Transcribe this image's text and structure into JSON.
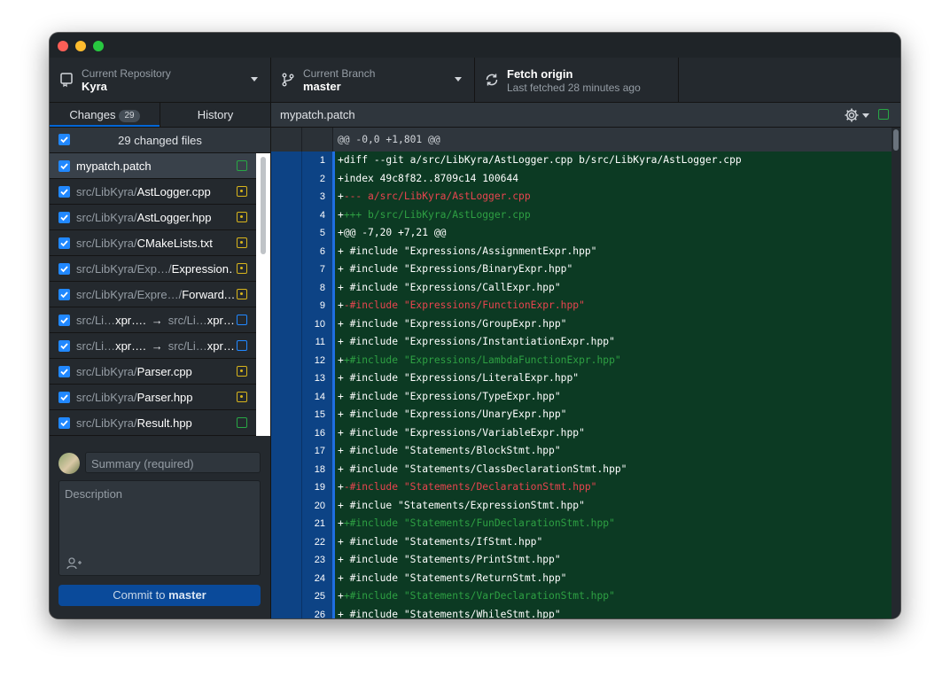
{
  "toolbar": {
    "repo": {
      "label": "Current Repository",
      "value": "Kyra",
      "icon": "repo-icon"
    },
    "branch": {
      "label": "Current Branch",
      "value": "master",
      "icon": "branch-icon"
    },
    "fetch": {
      "label": "Fetch origin",
      "subtitle": "Last fetched 28 minutes ago",
      "icon": "sync-icon"
    }
  },
  "tabs": {
    "changes": "Changes",
    "changes_count": "29",
    "history": "History"
  },
  "files_header": "29 changed files",
  "files": [
    {
      "dir": "",
      "name": "mypatch.patch",
      "status": "added"
    },
    {
      "dir": "src/LibKyra/",
      "name": "AstLogger.cpp",
      "status": "modified"
    },
    {
      "dir": "src/LibKyra/",
      "name": "AstLogger.hpp",
      "status": "modified"
    },
    {
      "dir": "src/LibKyra/",
      "name": "CMakeLists.txt",
      "status": "modified"
    },
    {
      "dir": "src/LibKyra/Exp…/",
      "name": "Expression…",
      "status": "modified"
    },
    {
      "dir": "src/LibKyra/Expre…/",
      "name": "Forward.…",
      "status": "modified"
    },
    {
      "dir": "src/Li…",
      "name": "xpr….",
      "arrow": "→",
      "dir2": "src/Li…",
      "name2": "xpr….",
      "status": "renamed"
    },
    {
      "dir": "src/Li…",
      "name": "xpr….",
      "arrow": "→",
      "dir2": "src/Li…",
      "name2": "xpr….",
      "status": "renamed"
    },
    {
      "dir": "src/LibKyra/",
      "name": "Parser.cpp",
      "status": "modified"
    },
    {
      "dir": "src/LibKyra/",
      "name": "Parser.hpp",
      "status": "modified"
    },
    {
      "dir": "src/LibKyra/",
      "name": "Result.hpp",
      "status": "added"
    }
  ],
  "commit": {
    "summary_placeholder": "Summary (required)",
    "description_placeholder": "Description",
    "button_prefix": "Commit to ",
    "button_branch": "master"
  },
  "diff": {
    "file": "mypatch.patch",
    "hunk": "@@ -0,0 +1,801 @@",
    "lines": [
      {
        "n": "1",
        "pre": "+",
        "text": "diff --git a/src/LibKyra/AstLogger.cpp b/src/LibKyra/AstLogger.cpp",
        "color": "white"
      },
      {
        "n": "2",
        "pre": "+",
        "text": "index 49c8f82..8709c14 100644",
        "color": "white"
      },
      {
        "n": "3",
        "pre": "+",
        "text": "--- a/src/LibKyra/AstLogger.cpp",
        "color": "red"
      },
      {
        "n": "4",
        "pre": "+",
        "text": "+++ b/src/LibKyra/AstLogger.cpp",
        "color": "green"
      },
      {
        "n": "5",
        "pre": "+",
        "text": "@@ -7,20 +7,21 @@",
        "color": "white"
      },
      {
        "n": "6",
        "pre": "+",
        "text": " #include \"Expressions/AssignmentExpr.hpp\"",
        "color": "white"
      },
      {
        "n": "7",
        "pre": "+",
        "text": " #include \"Expressions/BinaryExpr.hpp\"",
        "color": "white"
      },
      {
        "n": "8",
        "pre": "+",
        "text": " #include \"Expressions/CallExpr.hpp\"",
        "color": "white"
      },
      {
        "n": "9",
        "pre": "+",
        "text": "-#include \"Expressions/FunctionExpr.hpp\"",
        "color": "red"
      },
      {
        "n": "10",
        "pre": "+",
        "text": " #include \"Expressions/GroupExpr.hpp\"",
        "color": "white"
      },
      {
        "n": "11",
        "pre": "+",
        "text": " #include \"Expressions/InstantiationExpr.hpp\"",
        "color": "white"
      },
      {
        "n": "12",
        "pre": "+",
        "text": "+#include \"Expressions/LambdaFunctionExpr.hpp\"",
        "color": "green"
      },
      {
        "n": "13",
        "pre": "+",
        "text": " #include \"Expressions/LiteralExpr.hpp\"",
        "color": "white"
      },
      {
        "n": "14",
        "pre": "+",
        "text": " #include \"Expressions/TypeExpr.hpp\"",
        "color": "white"
      },
      {
        "n": "15",
        "pre": "+",
        "text": " #include \"Expressions/UnaryExpr.hpp\"",
        "color": "white"
      },
      {
        "n": "16",
        "pre": "+",
        "text": " #include \"Expressions/VariableExpr.hpp\"",
        "color": "white"
      },
      {
        "n": "17",
        "pre": "+",
        "text": " #include \"Statements/BlockStmt.hpp\"",
        "color": "white"
      },
      {
        "n": "18",
        "pre": "+",
        "text": " #include \"Statements/ClassDeclarationStmt.hpp\"",
        "color": "white"
      },
      {
        "n": "19",
        "pre": "+",
        "text": "-#include \"Statements/DeclarationStmt.hpp\"",
        "color": "red"
      },
      {
        "n": "20",
        "pre": "+",
        "text": " #inclue \"Statements/ExpressionStmt.hpp\"",
        "color": "white"
      },
      {
        "n": "21",
        "pre": "+",
        "text": "+#include \"Statements/FunDeclarationStmt.hpp\"",
        "color": "green"
      },
      {
        "n": "22",
        "pre": "+",
        "text": " #include \"Statements/IfStmt.hpp\"",
        "color": "white"
      },
      {
        "n": "23",
        "pre": "+",
        "text": " #include \"Statements/PrintStmt.hpp\"",
        "color": "white"
      },
      {
        "n": "24",
        "pre": "+",
        "text": " #include \"Statements/ReturnStmt.hpp\"",
        "color": "white"
      },
      {
        "n": "25",
        "pre": "+",
        "text": "+#include \"Statements/VarDeclarationStmt.hpp\"",
        "color": "green"
      },
      {
        "n": "26",
        "pre": "+",
        "text": " #include \"Statements/WhileStmt.hpp\"",
        "color": "white"
      }
    ]
  },
  "colors": {
    "accent": "#0366d6",
    "added": "#28a745",
    "modified": "#d8b51c",
    "renamed": "#2188ff",
    "removed_text": "#e8454f",
    "added_text": "#2ea043"
  }
}
